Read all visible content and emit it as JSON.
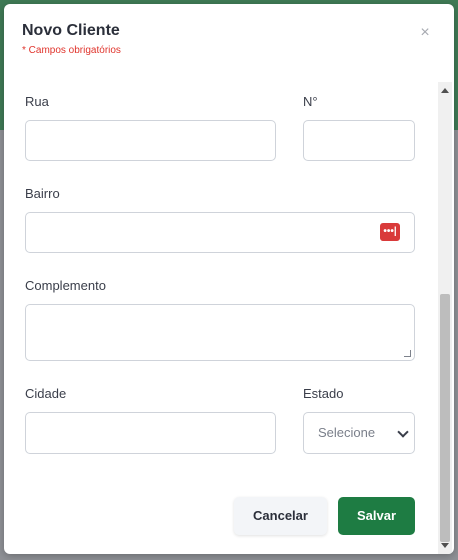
{
  "modal": {
    "title": "Novo Cliente",
    "subtitle": "* Campos obrigatórios",
    "close_label": "×"
  },
  "form": {
    "rua": {
      "label": "Rua",
      "value": ""
    },
    "numero": {
      "label": "N°",
      "value": ""
    },
    "bairro": {
      "label": "Bairro",
      "value": ""
    },
    "complemento": {
      "label": "Complemento",
      "value": ""
    },
    "cidade": {
      "label": "Cidade",
      "value": ""
    },
    "estado": {
      "label": "Estado",
      "selected": "Selecione"
    }
  },
  "buttons": {
    "cancel_label": "Cancelar",
    "save_label": "Salvar"
  },
  "icons": {
    "password_manager": "password-manager-icon",
    "close": "close-icon",
    "chevron": "chevron-down-icon"
  },
  "colors": {
    "save_button": "#1e7c43",
    "required_text": "#e0342c",
    "password_icon": "#d93a3a"
  }
}
